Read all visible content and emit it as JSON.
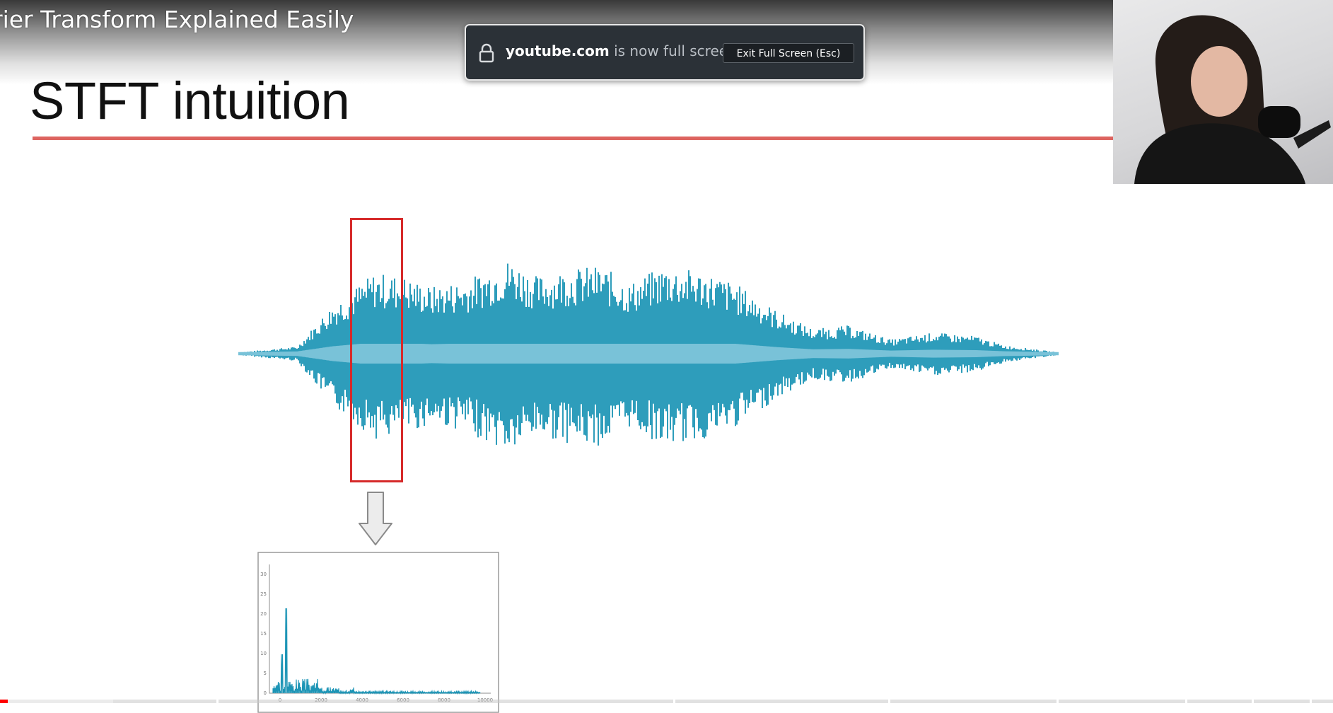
{
  "player": {
    "video_title": "rier Transform Explained Easily",
    "progress_fraction": 0.006,
    "buffered_fraction": 0.085
  },
  "fullscreen_notice": {
    "domain": "youtube.com",
    "message": " is now full screen",
    "exit_button_label": "Exit Full Screen (Esc)"
  },
  "slide": {
    "title": "STFT intuition",
    "colors": {
      "waveform": "#1d95b6",
      "window_box": "#d62a2a",
      "title_rule": "#d9534f"
    }
  },
  "spectrum_plot": {
    "y_ticks": [
      "30",
      "25",
      "20",
      "15",
      "10",
      "5",
      "0"
    ],
    "x_ticks": [
      "0",
      "2000",
      "4000",
      "6000",
      "8000",
      "10000"
    ]
  }
}
